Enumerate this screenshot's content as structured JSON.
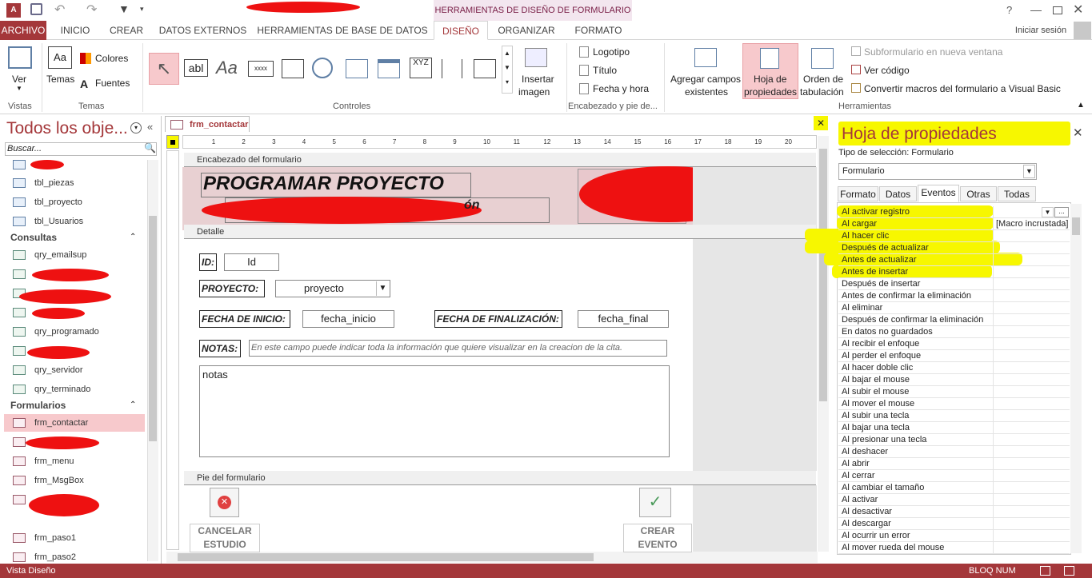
{
  "app": {
    "icon": "access-icon",
    "title_ctx": "HERRAMIENTAS DE DISEÑO DE FORMULARIO",
    "help": "?",
    "signin": "Iniciar sesión"
  },
  "tabs": [
    "ARCHIVO",
    "INICIO",
    "CREAR",
    "DATOS EXTERNOS",
    "HERRAMIENTAS DE BASE DE DATOS",
    "DISEÑO",
    "ORGANIZAR",
    "FORMATO"
  ],
  "ribbon": {
    "ver": "Ver",
    "vistas": "Vistas",
    "temas": "Temas",
    "colores": "Colores",
    "fuentes": "Fuentes",
    "temas_group": "Temas",
    "controles": "Controles",
    "insertar": "Insertar",
    "imagen": "imagen",
    "logotipo": "Logotipo",
    "titulo": "Título",
    "fecha_hora": "Fecha y hora",
    "encabezado": "Encabezado y pie de...",
    "agregar1": "Agregar campos",
    "agregar2": "existentes",
    "hoja1": "Hoja de",
    "hoja2": "propiedades",
    "orden1": "Orden de",
    "orden2": "tabulación",
    "subform": "Subformulario en nueva ventana",
    "vercodigo": "Ver código",
    "convertir": "Convertir macros del formulario a Visual Basic",
    "herramientas": "Herramientas"
  },
  "nav": {
    "title": "Todos los obje...",
    "search": "Buscar...",
    "tables": [
      "tbl_piezas",
      "tbl_proyecto",
      "tbl_Usuarios"
    ],
    "consultas_label": "Consultas",
    "queries": [
      "qry_emailsup",
      "qry_programado",
      "qry_servidor",
      "qry_terminado"
    ],
    "formularios_label": "Formularios",
    "forms": [
      "frm_contactar",
      "frm_menu",
      "frm_MsgBox",
      "frm_paso1",
      "frm_paso2"
    ]
  },
  "doc": {
    "tab": "frm_contactar",
    "ruler_marks": [
      "1",
      "2",
      "3",
      "4",
      "5",
      "6",
      "7",
      "8",
      "9",
      "10",
      "11",
      "12",
      "13",
      "14",
      "15",
      "16",
      "17",
      "18",
      "19",
      "20"
    ],
    "sec_header": "Encabezado del formulario",
    "header_title": "PROGRAMAR PROYECTO",
    "sec_detail": "Detalle",
    "lbl_id": "ID:",
    "fld_id": "Id",
    "lbl_proyecto": "PROYECTO:",
    "fld_proyecto": "proyecto",
    "lbl_inicio": "FECHA DE INICIO:",
    "fld_inicio": "fecha_inicio",
    "lbl_final": "FECHA DE FINALIZACIÓN:",
    "fld_final": "fecha_final",
    "lbl_notas": "NOTAS:",
    "notas_hint": "En este campo puede indicar toda la información que quiere visualizar en la creacion de la cita.",
    "fld_notas": "notas",
    "sec_footer": "Pie del formulario",
    "btn_cancel1": "CANCELAR",
    "btn_cancel2": "ESTUDIO",
    "btn_create1": "CREAR",
    "btn_create2": "EVENTO"
  },
  "props": {
    "title": "Hoja de propiedades",
    "sel_type": "Tipo de selección:  Formulario",
    "select_value": "Formulario",
    "tabs": [
      "Formato",
      "Datos",
      "Eventos",
      "Otras",
      "Todas"
    ],
    "rows": [
      {
        "name": "Al activar registro",
        "value": ""
      },
      {
        "name": "Al cargar",
        "value": "[Macro incrustada]"
      },
      {
        "name": "Al hacer clic",
        "value": ""
      },
      {
        "name": "Después de actualizar",
        "value": ""
      },
      {
        "name": "Antes de actualizar",
        "value": ""
      },
      {
        "name": "Antes de insertar",
        "value": ""
      },
      {
        "name": "Después de insertar",
        "value": ""
      },
      {
        "name": "Antes de confirmar la eliminación",
        "value": ""
      },
      {
        "name": "Al eliminar",
        "value": ""
      },
      {
        "name": "Después de confirmar la eliminación",
        "value": ""
      },
      {
        "name": "En datos no guardados",
        "value": ""
      },
      {
        "name": "Al recibir el enfoque",
        "value": ""
      },
      {
        "name": "Al perder el enfoque",
        "value": ""
      },
      {
        "name": "Al hacer doble clic",
        "value": ""
      },
      {
        "name": "Al bajar el mouse",
        "value": ""
      },
      {
        "name": "Al subir el mouse",
        "value": ""
      },
      {
        "name": "Al mover el mouse",
        "value": ""
      },
      {
        "name": "Al subir una tecla",
        "value": ""
      },
      {
        "name": "Al bajar una tecla",
        "value": ""
      },
      {
        "name": "Al presionar una tecla",
        "value": ""
      },
      {
        "name": "Al deshacer",
        "value": ""
      },
      {
        "name": "Al abrir",
        "value": ""
      },
      {
        "name": "Al cerrar",
        "value": ""
      },
      {
        "name": "Al cambiar el tamaño",
        "value": ""
      },
      {
        "name": "Al activar",
        "value": ""
      },
      {
        "name": "Al desactivar",
        "value": ""
      },
      {
        "name": "Al descargar",
        "value": ""
      },
      {
        "name": "Al ocurrir un error",
        "value": ""
      },
      {
        "name": "Al mover rueda del mouse",
        "value": ""
      }
    ]
  },
  "status": {
    "left": "Vista Diseño",
    "right": "BLOQ NUM"
  }
}
